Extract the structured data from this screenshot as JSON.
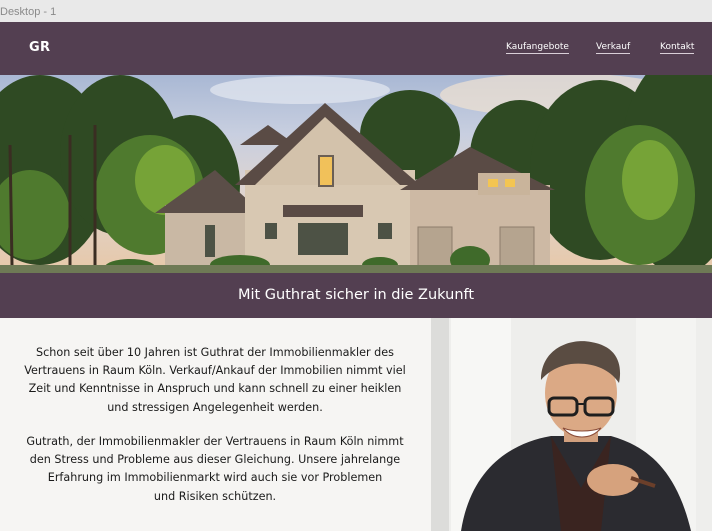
{
  "frame": {
    "label": "Desktop - 1"
  },
  "navbar": {
    "logo": "GR",
    "links": [
      {
        "label": "Kaufangebote"
      },
      {
        "label": "Verkauf"
      },
      {
        "label": "Kontakt"
      }
    ]
  },
  "banner": {
    "title": "Mit Guthrat sicher in die Zukunft"
  },
  "content": {
    "paragraphs": [
      "Schon seit über 10 Jahren ist Guthrat der Immobilienmakler des\nVertrauens in Raum Köln. Verkauf/Ankauf der Immobilien nimmt viel\nZeit und Kenntnisse in Anspruch und kann schnell zu einer heiklen\nund stressigen Angelegenheit werden.",
      "Gutrath, der Immobilienmakler der Vertrauens in Raum Köln nimmt\nden Stress und Probleme aus dieser Gleichung. Unsere jahrelange\nErfahrung im Immobilienmarkt wird auch sie vor Problemen\nund Risiken schützen."
    ]
  },
  "colors": {
    "brand": "#533f51",
    "content_bg": "#f6f5f3",
    "text": "#1a1a1a"
  },
  "images": {
    "hero": "house-photo",
    "portrait": "smiling-man-portrait"
  }
}
